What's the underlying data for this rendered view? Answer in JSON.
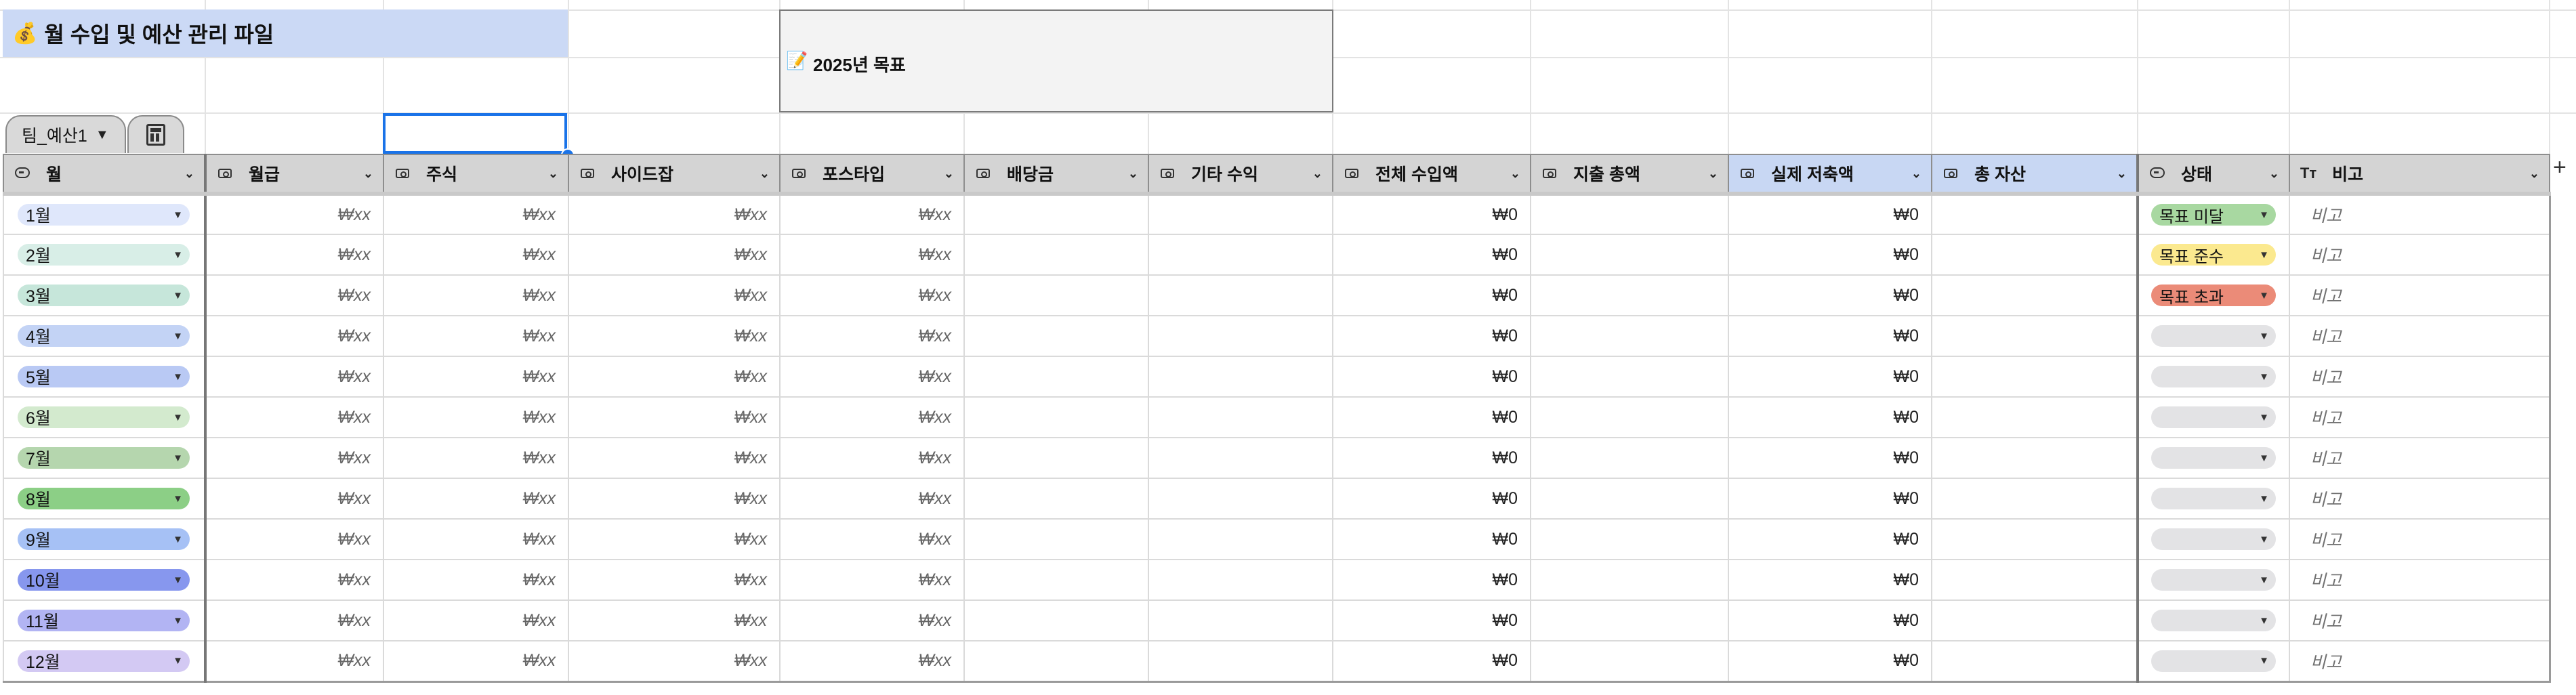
{
  "sheet": {
    "title": "월 수입 및 예산 관리 파일",
    "title_icon": "💰",
    "goal_text": "2025년 목표",
    "goal_icon": "📝"
  },
  "tabs": {
    "active": "팀_예산1",
    "calculator_icon": "calculator-icon"
  },
  "columns": {
    "month": "월",
    "salary": "월급",
    "stock": "주식",
    "sidejob": "사이드잡",
    "postype": "포스타입",
    "dividend": "배당금",
    "other": "기타 수익",
    "total": "전체 수입액",
    "expense": "지출 총액",
    "savings": "실제 저축액",
    "assets": "총 자산",
    "status": "상태",
    "memo": "비고"
  },
  "colors": {
    "header_gray": "#d4d4d4",
    "header_blue": "#c8d7f3",
    "title_bg": "#cbd9f5",
    "status_miss": "#a8d8a1",
    "status_keep": "#fbe98f",
    "status_over": "#eb8b78",
    "status_empty": "#e3e3e5"
  },
  "rows": [
    {
      "month": "1월",
      "color": "#dfe7fb",
      "salary": "₩xx",
      "stock": "₩xx",
      "sidejob": "₩xx",
      "postype": "₩xx",
      "total": "₩0",
      "savings": "₩0",
      "status": "목표 미달",
      "status_color": "#a8d8a1",
      "memo": "비고"
    },
    {
      "month": "2월",
      "color": "#d8eee7",
      "salary": "₩xx",
      "stock": "₩xx",
      "sidejob": "₩xx",
      "postype": "₩xx",
      "total": "₩0",
      "savings": "₩0",
      "status": "목표 준수",
      "status_color": "#fbe98f",
      "memo": "비고"
    },
    {
      "month": "3월",
      "color": "#c6e6da",
      "salary": "₩xx",
      "stock": "₩xx",
      "sidejob": "₩xx",
      "postype": "₩xx",
      "total": "₩0",
      "savings": "₩0",
      "status": "목표 초과",
      "status_color": "#eb8b78",
      "memo": "비고"
    },
    {
      "month": "4월",
      "color": "#c3d3f5",
      "salary": "₩xx",
      "stock": "₩xx",
      "sidejob": "₩xx",
      "postype": "₩xx",
      "total": "₩0",
      "savings": "₩0",
      "status": "",
      "status_color": "#e3e3e5",
      "memo": "비고"
    },
    {
      "month": "5월",
      "color": "#b9c9f4",
      "salary": "₩xx",
      "stock": "₩xx",
      "sidejob": "₩xx",
      "postype": "₩xx",
      "total": "₩0",
      "savings": "₩0",
      "status": "",
      "status_color": "#e3e3e5",
      "memo": "비고"
    },
    {
      "month": "6월",
      "color": "#d3eace",
      "salary": "₩xx",
      "stock": "₩xx",
      "sidejob": "₩xx",
      "postype": "₩xx",
      "total": "₩0",
      "savings": "₩0",
      "status": "",
      "status_color": "#e3e3e5",
      "memo": "비고"
    },
    {
      "month": "7월",
      "color": "#b5d6ae",
      "salary": "₩xx",
      "stock": "₩xx",
      "sidejob": "₩xx",
      "postype": "₩xx",
      "total": "₩0",
      "savings": "₩0",
      "status": "",
      "status_color": "#e3e3e5",
      "memo": "비고"
    },
    {
      "month": "8월",
      "color": "#8ccf86",
      "salary": "₩xx",
      "stock": "₩xx",
      "sidejob": "₩xx",
      "postype": "₩xx",
      "total": "₩0",
      "savings": "₩0",
      "status": "",
      "status_color": "#e3e3e5",
      "memo": "비고"
    },
    {
      "month": "9월",
      "color": "#a6c1f5",
      "salary": "₩xx",
      "stock": "₩xx",
      "sidejob": "₩xx",
      "postype": "₩xx",
      "total": "₩0",
      "savings": "₩0",
      "status": "",
      "status_color": "#e3e3e5",
      "memo": "비고"
    },
    {
      "month": "10월",
      "color": "#8797ee",
      "salary": "₩xx",
      "stock": "₩xx",
      "sidejob": "₩xx",
      "postype": "₩xx",
      "total": "₩0",
      "savings": "₩0",
      "status": "",
      "status_color": "#e3e3e5",
      "memo": "비고"
    },
    {
      "month": "11월",
      "color": "#b2b4f3",
      "salary": "₩xx",
      "stock": "₩xx",
      "sidejob": "₩xx",
      "postype": "₩xx",
      "total": "₩0",
      "savings": "₩0",
      "status": "",
      "status_color": "#e3e3e5",
      "memo": "비고"
    },
    {
      "month": "12월",
      "color": "#d3c9f3",
      "salary": "₩xx",
      "stock": "₩xx",
      "sidejob": "₩xx",
      "postype": "₩xx",
      "total": "₩0",
      "savings": "₩0",
      "status": "",
      "status_color": "#e3e3e5",
      "memo": "비고"
    }
  ],
  "add_column": "+"
}
